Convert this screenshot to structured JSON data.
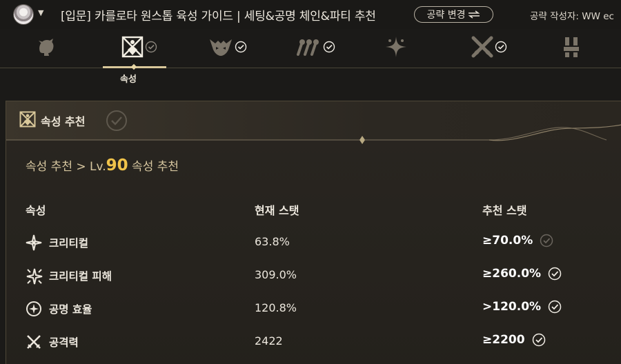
{
  "header": {
    "title": "[입문] 카를로타 원스톱 육성 가이드 | 세팅&공명 체인&파티 추천",
    "change_button": "공략 변경",
    "change_icon": "swap-arrows-icon",
    "author": "공략 작성자: WW ec"
  },
  "tabs": [
    {
      "icon": "character-portrait-icon",
      "checked": false
    },
    {
      "icon": "attribute-icon",
      "checked": true,
      "label": "속성",
      "active": true
    },
    {
      "icon": "echo-icon",
      "checked": true
    },
    {
      "icon": "skill-chain-icon",
      "checked": true
    },
    {
      "icon": "sparkle-icon",
      "checked": false
    },
    {
      "icon": "crossed-swords-icon",
      "checked": true
    },
    {
      "icon": "party-icon",
      "checked": false
    }
  ],
  "panel": {
    "title": "속성 추천",
    "breadcrumb_prefix": "속성 추천 > Lv.",
    "level": "90",
    "breadcrumb_suffix": " 속성 추천",
    "columns": {
      "attribute": "속성",
      "current": "현재 스탯",
      "recommended": "추천 스탯"
    },
    "rows": [
      {
        "icon": "crit-rate-icon",
        "name": "크리티컬",
        "current": "63.8%",
        "recommended": "≥70.0%",
        "met": false
      },
      {
        "icon": "crit-damage-icon",
        "name": "크리티컬 피해",
        "current": "309.0%",
        "recommended": "≥260.0%",
        "met": true
      },
      {
        "icon": "energy-regen-icon",
        "name": "공명 효율",
        "current": "120.8%",
        "recommended": ">120.0%",
        "met": true
      },
      {
        "icon": "attack-icon",
        "name": "공격력",
        "current": "2422",
        "recommended": "≥2200",
        "met": true
      }
    ]
  },
  "colors": {
    "accent_gold": "#f0c34a",
    "check_met": "#f2eee6",
    "check_unmet": "#6b665e"
  }
}
